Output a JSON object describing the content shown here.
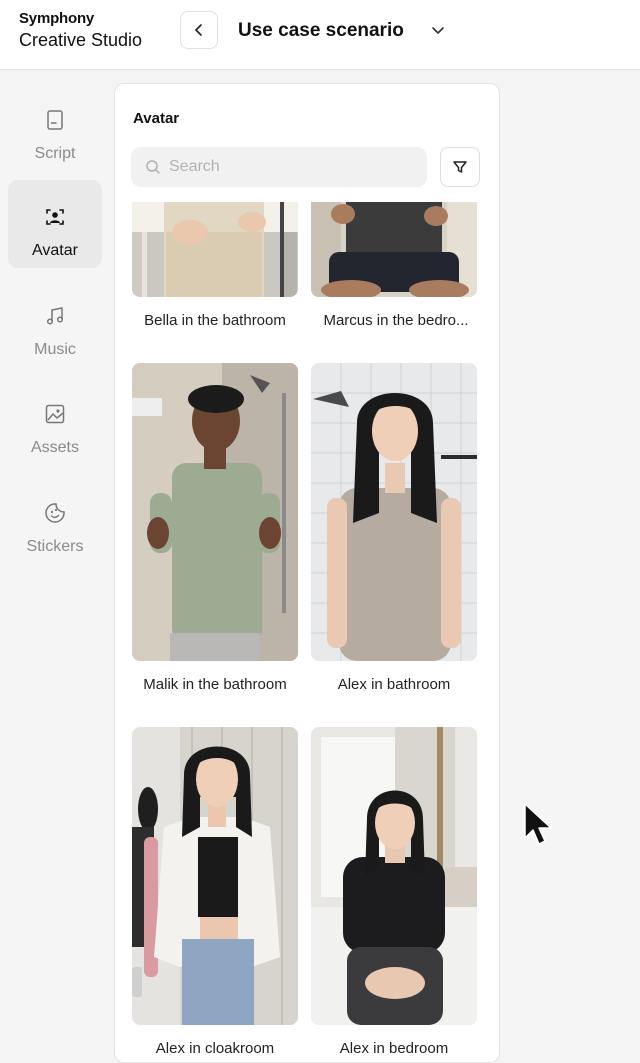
{
  "brand": {
    "line1": "Symphony",
    "line2": "Creative Studio"
  },
  "header": {
    "title": "Use case scenario",
    "icons": [
      "chevron-left-icon",
      "chevron-down-icon"
    ]
  },
  "sidebar": {
    "items": [
      {
        "label": "Script",
        "icon": "script-icon",
        "active": false
      },
      {
        "label": "Avatar",
        "icon": "avatar-icon",
        "active": true
      },
      {
        "label": "Music",
        "icon": "music-icon",
        "active": false
      },
      {
        "label": "Assets",
        "icon": "image-icon",
        "active": false
      },
      {
        "label": "Stickers",
        "icon": "sticker-icon",
        "active": false
      }
    ]
  },
  "panel": {
    "title": "Avatar",
    "search": {
      "placeholder": "Search",
      "value": ""
    },
    "filter_icon": "filter-icon",
    "avatars": [
      {
        "name": "Bella in the bathroom"
      },
      {
        "name": "Marcus in the bedro..."
      },
      {
        "name": "Malik in the bathroom"
      },
      {
        "name": "Alex in bathroom"
      },
      {
        "name": "Alex in cloakroom"
      },
      {
        "name": "Alex in bedroom"
      }
    ]
  },
  "colors": {
    "active_bg": "#e9e9e9",
    "inactive_text": "#8a8a8a",
    "panel_border": "#e3e3e3"
  }
}
